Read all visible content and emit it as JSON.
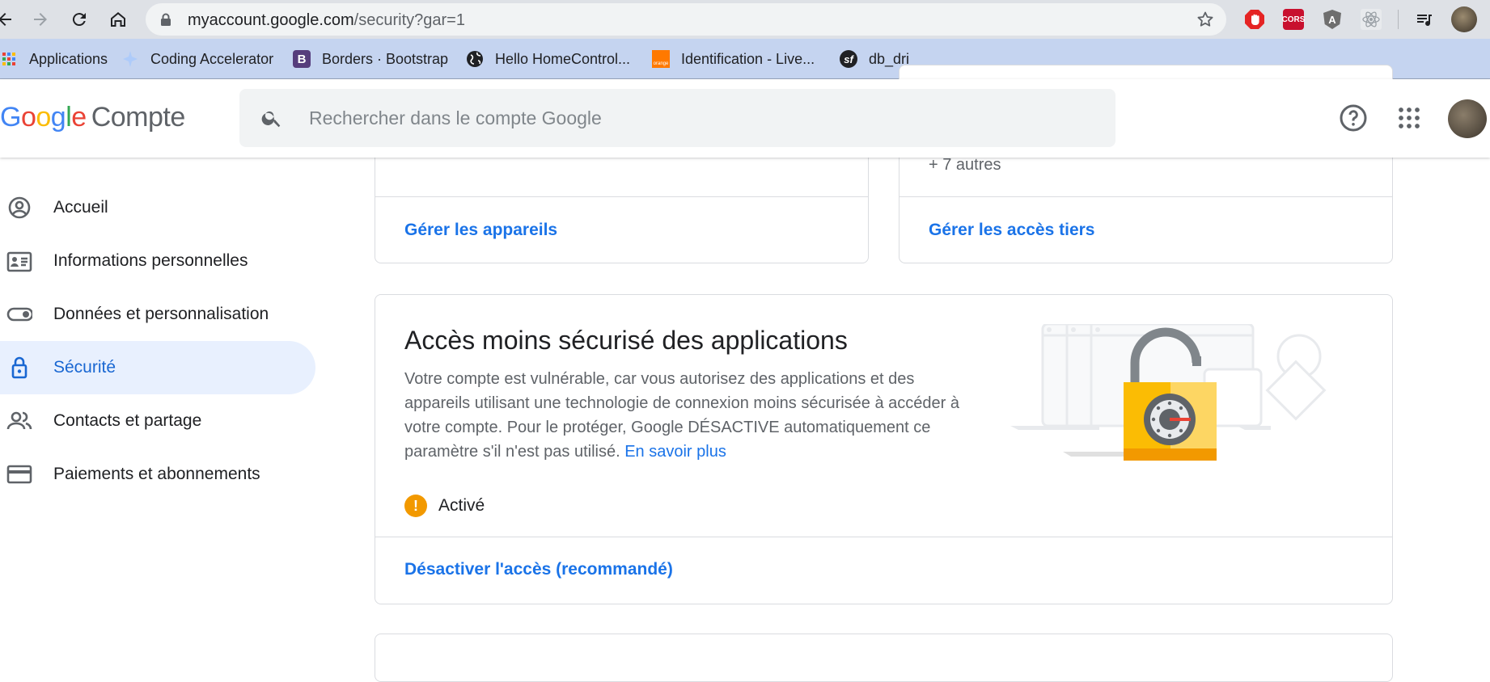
{
  "browser": {
    "url_host": "myaccount.google.com",
    "url_path": "/security?gar=1",
    "extensions": [
      {
        "name": "adblock-extension-icon",
        "color": "#e52424"
      },
      {
        "name": "cors-extension-icon",
        "label": "CORS",
        "color": "#c8102e"
      },
      {
        "name": "angular-extension-icon",
        "label": "A",
        "color": "#6e6e6e"
      },
      {
        "name": "react-extension-icon",
        "color": "#9aa0a6"
      }
    ]
  },
  "bookmarks": [
    {
      "label": "Applications",
      "icon": "apps-grid-icon"
    },
    {
      "label": "Coding Accelerator",
      "icon": "sparkle-icon"
    },
    {
      "label": "Borders · Bootstrap",
      "icon": "bootstrap-icon"
    },
    {
      "label": "Hello HomeControl...",
      "icon": "globe-icon"
    },
    {
      "label": "Identification - Live...",
      "icon": "orange-icon"
    },
    {
      "label": "db_dri",
      "icon": "symfony-icon"
    }
  ],
  "header": {
    "logo_google": "Google",
    "logo_product": "Compte",
    "search_placeholder": "Rechercher dans le compte Google"
  },
  "sidebar": {
    "items": [
      {
        "label": "Accueil",
        "icon": "account-circle-icon",
        "active": false
      },
      {
        "label": "Informations personnelles",
        "icon": "id-card-icon",
        "active": false
      },
      {
        "label": "Données et personnalisation",
        "icon": "toggle-icon",
        "active": false
      },
      {
        "label": "Sécurité",
        "icon": "lock-icon",
        "active": true
      },
      {
        "label": "Contacts et partage",
        "icon": "people-icon",
        "active": false
      },
      {
        "label": "Paiements et abonnements",
        "icon": "credit-card-icon",
        "active": false
      }
    ]
  },
  "cards": {
    "devices_link": "Gérer les appareils",
    "third_party_more": "+ 7 autres",
    "third_party_link": "Gérer les accès tiers",
    "less_secure": {
      "title": "Accès moins sécurisé des applications",
      "description": "Votre compte est vulnérable, car vous autorisez des applications et des appareils utilisant une technologie de connexion moins sécurisée à accéder à votre compte. Pour le protéger, Google DÉSACTIVE automatiquement ce paramètre s'il n'est pas utilisé.",
      "learn_more": "En savoir plus",
      "status": "Activé",
      "action": "Désactiver l'accès (recommandé)"
    }
  },
  "colors": {
    "accent": "#1a73e8",
    "active_nav_bg": "#e8f0fe",
    "warning": "#f29900"
  }
}
